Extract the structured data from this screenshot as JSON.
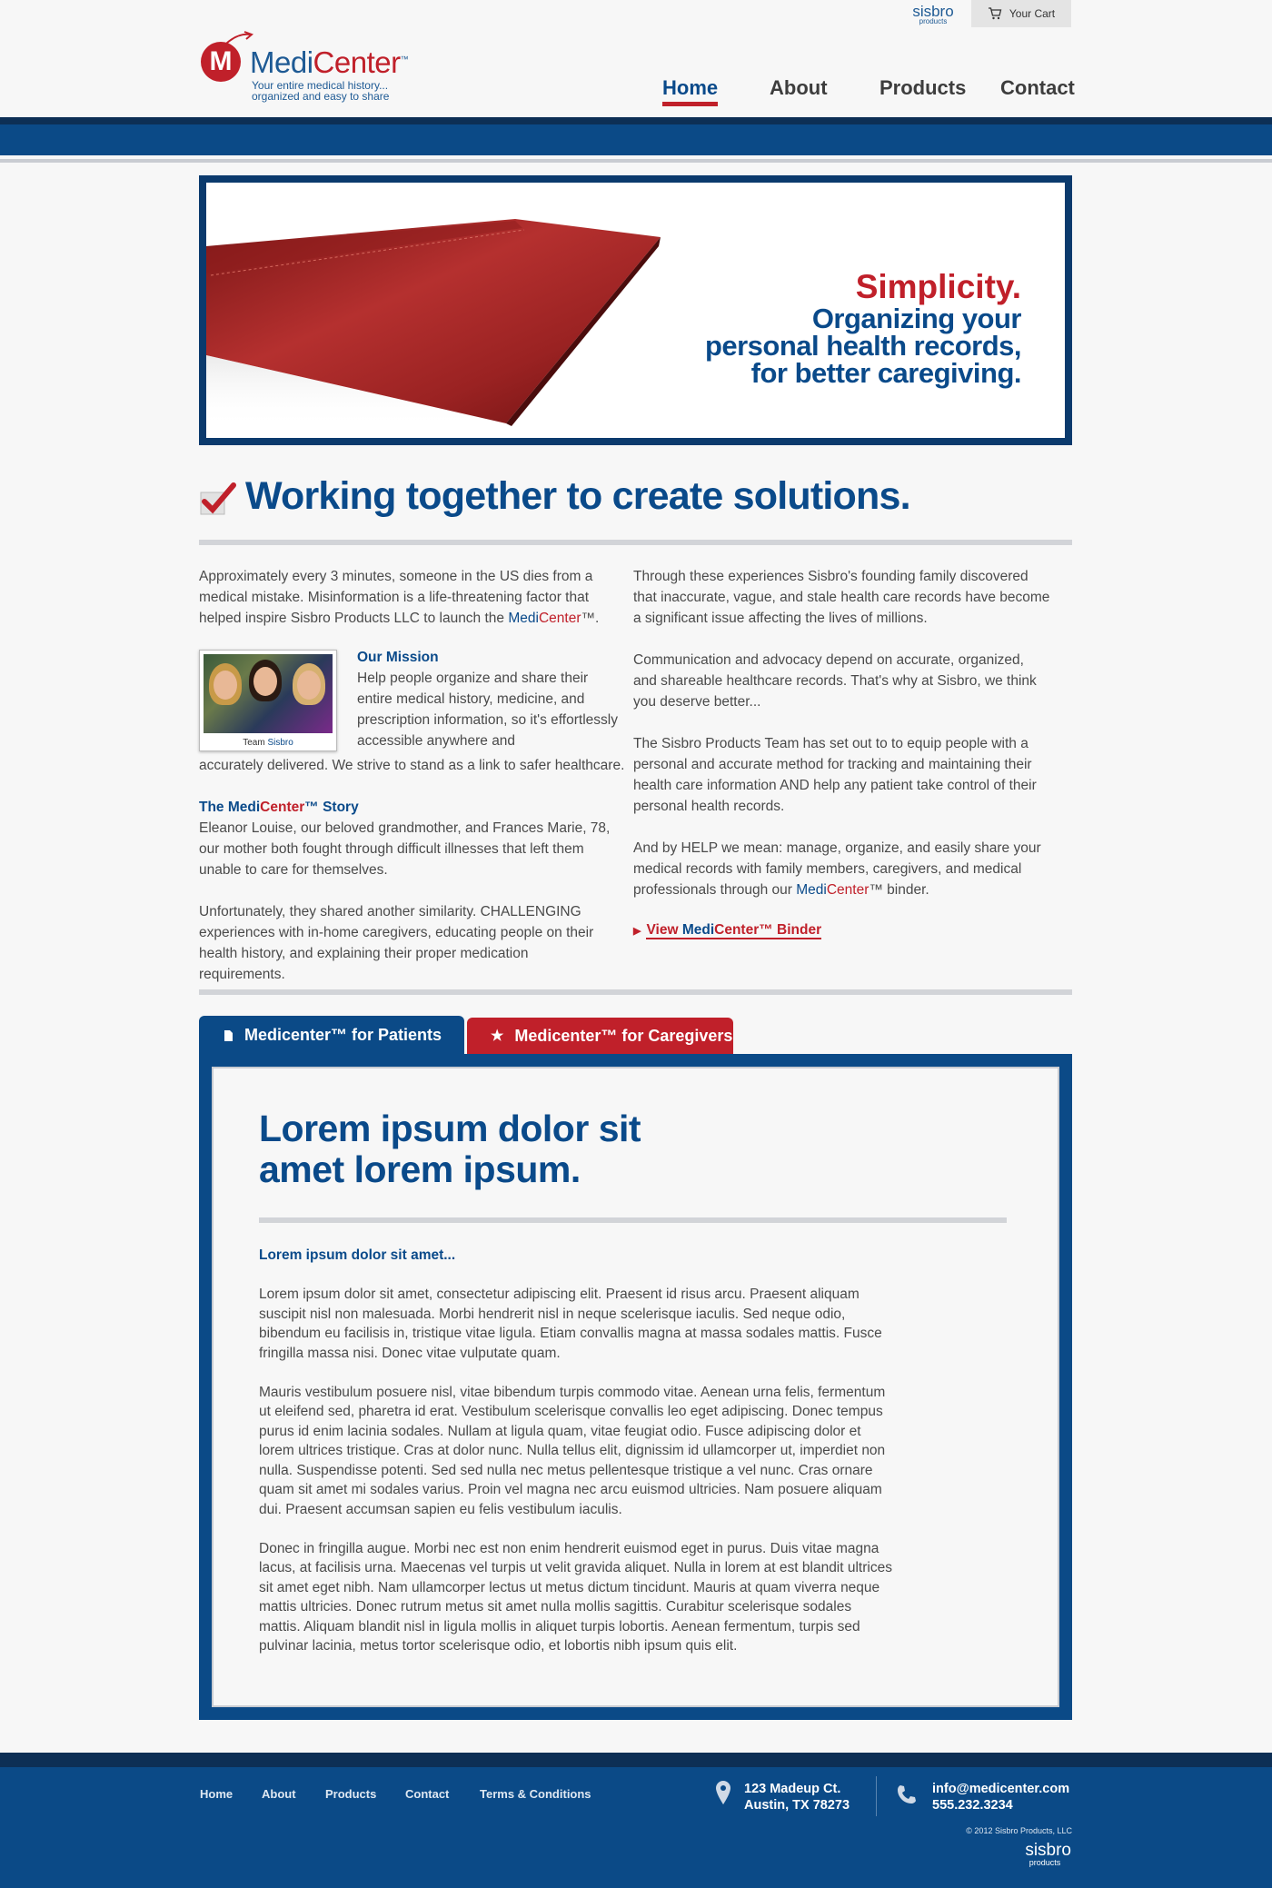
{
  "header": {
    "sisbro_top": "sisbro",
    "sisbro_top_small": "products",
    "cart_label": "Your Cart",
    "logo": {
      "mark": "M",
      "name_a": "Medi",
      "name_b": "Center",
      "tm": "™",
      "tagline_1": "Your entire medical history...",
      "tagline_2": "organized and easy to share"
    },
    "nav": [
      {
        "label": "Home",
        "active": true
      },
      {
        "label": "About",
        "active": false
      },
      {
        "label": "Products",
        "active": false
      },
      {
        "label": "Contact",
        "active": false
      }
    ]
  },
  "hero": {
    "title": "Simplicity.",
    "line_1": "Organizing your",
    "line_2": "personal health records,",
    "line_3": "for better caregiving."
  },
  "section": {
    "title": "Working together to create solutions.",
    "left": {
      "intro": "Approximately every 3 minutes, someone in the US dies from a medical mistake. Misinformation is a life-threatening factor that helped inspire Sisbro Products LLC to launch the ",
      "intro_medi": "Medi",
      "intro_center": "Center",
      "intro_end": "™.",
      "photo_caption_a": "Team ",
      "photo_caption_b": "Sisbro",
      "mission_title": "Our Mission",
      "mission_text": "Help people organize and share their entire medical history, medicine, and prescription information, so it's effortlessly accessible anywhere and",
      "mission_text_end": "accurately delivered. We strive to stand as a link to safer healthcare.",
      "story_title_a": "The Medi",
      "story_title_b": "Center",
      "story_title_c": "™ Story",
      "story_1": "Eleanor Louise, our beloved grandmother, and Frances Marie, 78, our mother both fought through difficult illnesses that left them unable to care for themselves.",
      "story_2": "Unfortunately, they shared another similarity. CHALLENGING experiences with in-home caregivers, educating people on their health history, and explaining their proper medication requirements."
    },
    "right": {
      "p1": "Through these experiences Sisbro's founding family discovered that inaccurate, vague, and stale health care records have become a significant issue affecting the lives of millions.",
      "p2": "Communication and advocacy depend on accurate, organized, and shareable healthcare records. That's why at Sisbro, we think you deserve better...",
      "p3": "The Sisbro Products Team has set out to to equip people with a personal and accurate method for tracking and maintaining their health care information AND help any patient take control of their personal health records.",
      "p4": "And by HELP we mean: manage, organize, and easily share your medical records with family members, caregivers, and medical professionals through our ",
      "p4_medi": "Medi",
      "p4_center": "Center",
      "p4_end": "™ binder.",
      "link_a": "View ",
      "link_medi": "Medi",
      "link_center": "Center",
      "link_end": "™ Binder"
    }
  },
  "tabs": {
    "patients": "Medicenter™ for Patients",
    "caregivers": "Medicenter™ for Caregivers"
  },
  "panel": {
    "title_1": "Lorem ipsum dolor sit",
    "title_2": "amet lorem ipsum.",
    "subtitle": "Lorem ipsum dolor sit amet...",
    "p1": "Lorem ipsum dolor sit amet, consectetur adipiscing elit. Praesent id risus arcu. Praesent aliquam suscipit nisl non malesuada. Morbi hendrerit nisl in neque scelerisque iaculis. Sed neque odio, bibendum eu facilisis in, tristique vitae ligula. Etiam convallis magna at massa sodales mattis. Fusce fringilla massa nisi. Donec vitae vulputate quam.",
    "p2": "Mauris vestibulum posuere nisl, vitae bibendum turpis commodo vitae. Aenean urna felis, fermentum ut eleifend sed, pharetra id erat. Vestibulum scelerisque convallis leo eget adipiscing. Donec tempus purus id enim lacinia sodales. Nullam at ligula quam, vitae feugiat odio. Fusce adipiscing dolor et lorem ultrices tristique. Cras at dolor nunc. Nulla tellus elit, dignissim id ullamcorper ut, imperdiet non nulla. Suspendisse potenti. Sed sed nulla nec metus pellentesque tristique a vel nunc. Cras ornare quam sit amet mi sodales varius. Proin vel magna nec arcu euismod ultricies. Nam posuere aliquam dui. Praesent accumsan sapien eu felis vestibulum iaculis.",
    "p3": "Donec in fringilla augue. Morbi nec est non enim  hendrerit euismod eget in purus. Duis vitae magna lacus, at facilisis urna. Maecenas vel turpis ut velit gravida aliquet. Nulla in lorem at est blandit ultrices sit amet eget nibh. Nam ullamcorper lectus ut metus dictum tincidunt. Mauris at quam viverra neque mattis ultricies. Donec rutrum metus sit amet nulla mollis sagittis. Curabitur scelerisque sodales mattis. Aliquam blandit nisl in ligula mollis in aliquet turpis lobortis. Aenean fermentum, turpis sed pulvinar lacinia, metus tortor scelerisque odio, et lobortis nibh ipsum quis elit."
  },
  "footer": {
    "links": [
      "Home",
      "About",
      "Products",
      "Contact",
      "Terms & Conditions"
    ],
    "address_1": "123 Madeup Ct.",
    "address_2": "Austin, TX 78273",
    "email": "info@medicenter.com",
    "phone": "555.232.3234",
    "copyright": "© 2012 Sisbro Products, LLC",
    "sisbro": "sisbro",
    "sisbro_small": "products"
  },
  "colors": {
    "brand_blue": "#0b4a87",
    "brand_red": "#c0202a",
    "dark_navy": "#0d2f55"
  }
}
